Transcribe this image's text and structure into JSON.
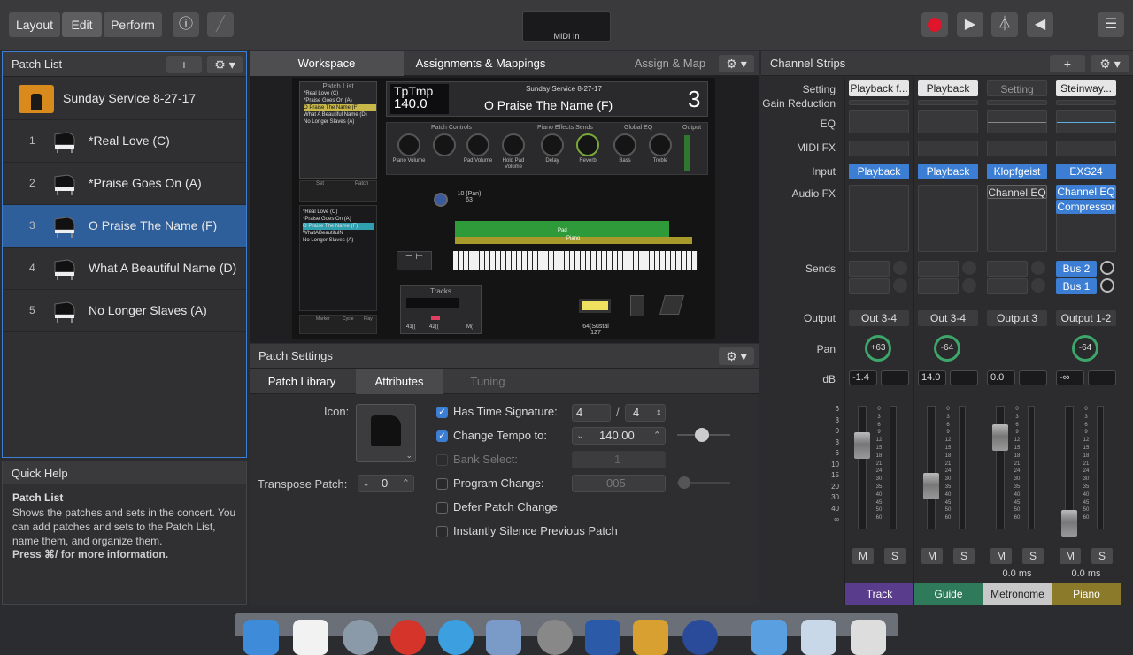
{
  "toolbar": {
    "layout": "Layout",
    "edit": "Edit",
    "perform": "Perform",
    "midi_in": "MIDI In"
  },
  "patch_list": {
    "title": "Patch List",
    "set_name": "Sunday Service 8-27-17",
    "patches": [
      {
        "num": "1",
        "name": "*Real Love (C)"
      },
      {
        "num": "2",
        "name": "*Praise Goes On (A)"
      },
      {
        "num": "3",
        "name": "O Praise The Name (F)"
      },
      {
        "num": "4",
        "name": "What A Beautiful Name (D)"
      },
      {
        "num": "5",
        "name": "No Longer Slaves (A)"
      }
    ],
    "selected_index": 3
  },
  "quick_help": {
    "title": "Quick Help",
    "heading": "Patch List",
    "body": "Shows the patches and sets in the concert. You can add patches and sets to the Patch List, name them, and organize them.",
    "more": "Press ⌘/ for more information."
  },
  "workspace": {
    "tab_workspace": "Workspace",
    "tab_assignments": "Assignments & Mappings",
    "assign_map": "Assign & Map",
    "tempo_label": "TpTmp",
    "tempo_value": "140.0",
    "set_title": "Sunday Service 8-27-17",
    "patch_title": "O Praise The Name (F)",
    "patch_number": "3",
    "section_patch_controls": "Patch Controls",
    "section_piano_effects": "Piano Effects Sends",
    "section_global_eq": "Global EQ",
    "section_output": "Output",
    "knobs": [
      "Piano Volume",
      "",
      "Pad Volume",
      "Hold Pad Volume",
      "Delay",
      "Reverb",
      "Bass",
      "Treble"
    ],
    "mini_patch_list_title": "Patch List",
    "mini_patches": [
      "*Real Love (C)",
      "*Praise Goes On (A)",
      "O Praise The Name (F)",
      "What A Beautiful Name (D)",
      "No Longer Slaves (A)"
    ],
    "mini_list2": [
      "*Real Love (C)",
      "*Praise Goes On (A)",
      "O Praise The Name (F)",
      "WhatABeautifulN",
      "No Longer Slaves (A)"
    ],
    "mini_set": "Set",
    "mini_patch": "Patch",
    "pan_label": "10 (Pan)",
    "pan_value": "63",
    "pad_label": "Pad",
    "piano_label": "Piano",
    "tracks_label": "Tracks",
    "track_val1": "41((",
    "track_val2": "42((",
    "track_val3": "M(",
    "sustain_label": "64(Sustai",
    "sustain_value": "127",
    "marker": "Marker",
    "cycle": "Cycle",
    "play": "Play"
  },
  "patch_settings": {
    "title": "Patch Settings",
    "tab_library": "Patch Library",
    "tab_attributes": "Attributes",
    "tab_tuning": "Tuning",
    "icon_label": "Icon:",
    "transpose_label": "Transpose Patch:",
    "transpose_value": "0",
    "has_time_sig": "Has Time Signature:",
    "time_sig_num": "4",
    "time_sig_den": "4",
    "time_sig_sep": "/",
    "change_tempo": "Change Tempo to:",
    "tempo": "140.00",
    "bank_select": "Bank Select:",
    "bank_value": "1",
    "program_change": "Program Change:",
    "program_value": "005",
    "defer": "Defer Patch Change",
    "silence": "Instantly Silence Previous Patch"
  },
  "channel_strips": {
    "title": "Channel Strips",
    "labels": {
      "setting": "Setting",
      "gain": "Gain Reduction",
      "eq": "EQ",
      "midifx": "MIDI FX",
      "input": "Input",
      "audiofx": "Audio FX",
      "sends": "Sends",
      "output": "Output",
      "pan": "Pan",
      "db": "dB"
    },
    "scale": [
      "6",
      "3",
      "0",
      "3",
      "6",
      "10",
      "15",
      "20",
      "30",
      "40",
      "∞"
    ],
    "meter_scale": [
      "0",
      "3",
      "6",
      "9",
      "12",
      "15",
      "18",
      "21",
      "24",
      "30",
      "35",
      "40",
      "45",
      "50",
      "60"
    ],
    "strips": [
      {
        "setting": "Playback f...",
        "input": "Playback",
        "audiofx": [],
        "sends": [],
        "output": "Out 3-4",
        "pan": "+63",
        "db": "-1.4",
        "latency": "",
        "name": "Track",
        "color": "#5a3c8c"
      },
      {
        "setting": "Playback",
        "input": "Playback",
        "audiofx": [],
        "sends": [],
        "output": "Out 3-4",
        "pan": "-64",
        "db": "14.0",
        "latency": "",
        "name": "Guide",
        "color": "#2f7a5a"
      },
      {
        "setting": "Setting",
        "input": "Klopfgeist",
        "audiofx": [
          "Channel EQ"
        ],
        "sends": [],
        "output": "Output 3",
        "pan": "",
        "db": "0.0",
        "latency": "0.0 ms",
        "name": "Metronome",
        "color": "#c8c8c8"
      },
      {
        "setting": "Steinway...",
        "input": "EXS24",
        "audiofx": [
          "Channel EQ",
          "Compressor"
        ],
        "sends": [
          "Bus 2",
          "Bus 1"
        ],
        "output": "Output 1-2",
        "pan": "-64",
        "db": "-∞",
        "latency": "0.0 ms",
        "name": "Piano",
        "color": "#8a7a2a"
      }
    ],
    "mute": "M",
    "solo": "S"
  }
}
